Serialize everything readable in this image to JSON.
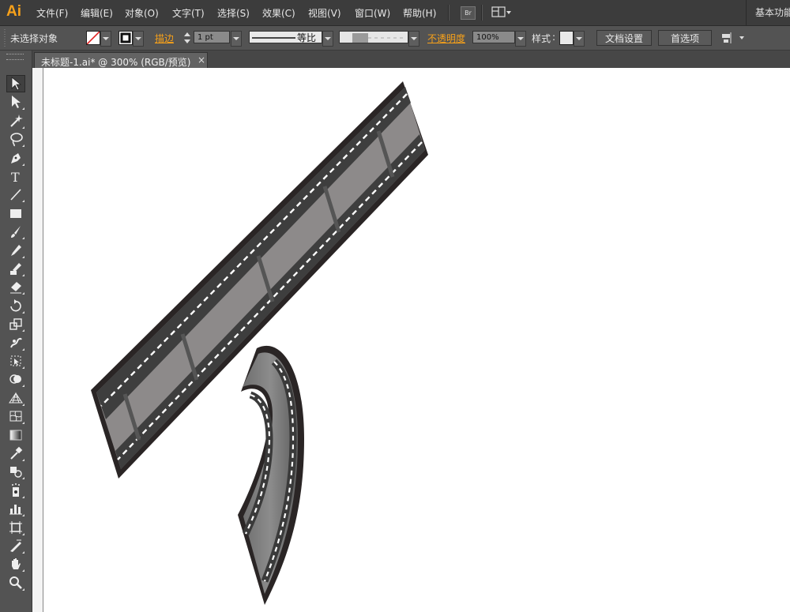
{
  "app": {
    "logo": "Ai"
  },
  "menu": {
    "items": [
      "文件(F)",
      "编辑(E)",
      "对象(O)",
      "文字(T)",
      "选择(S)",
      "效果(C)",
      "视图(V)",
      "窗口(W)",
      "帮助(H)"
    ],
    "bridge_label": "Br",
    "workspace": "基本功能"
  },
  "control": {
    "selection_status": "未选择对象",
    "stroke_label": "描边",
    "stroke_weight": "1 pt",
    "brush_label": "等比",
    "opacity_label": "不透明度",
    "opacity_value": "100%",
    "style_label": "样式",
    "doc_setup_button": "文档设置",
    "preferences_button": "首选项"
  },
  "document": {
    "tab_title": "未标题-1.ai* @ 300% (RGB/预览)",
    "close_glyph": "×"
  },
  "colors": {
    "accent": "#f7a11a",
    "ui_dark": "#3c3c3c",
    "ui_mid": "#535353",
    "film_frame": "#8a8a8a",
    "film_edge": "#2a2525"
  },
  "tools": [
    "selection-tool",
    "direct-selection-tool",
    "magic-wand-tool",
    "lasso-tool",
    "pen-tool",
    "type-tool",
    "line-segment-tool",
    "rectangle-tool",
    "paintbrush-tool",
    "pencil-tool",
    "blob-brush-tool",
    "eraser-tool",
    "rotate-tool",
    "scale-tool",
    "warp-tool",
    "free-transform-tool",
    "shape-builder-tool",
    "perspective-grid-tool",
    "mesh-tool",
    "gradient-tool",
    "eyedropper-tool",
    "blend-tool",
    "symbol-sprayer-tool",
    "column-graph-tool",
    "artboard-tool",
    "slice-tool",
    "hand-tool",
    "zoom-tool"
  ]
}
